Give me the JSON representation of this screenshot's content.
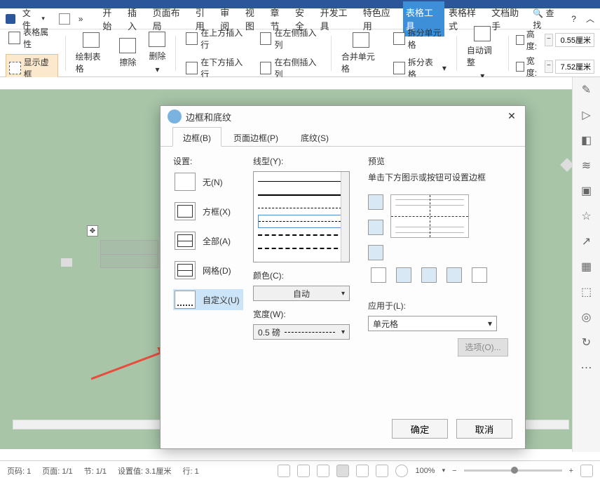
{
  "menu": {
    "file": "文件",
    "tabs": [
      "开始",
      "插入",
      "页面布局",
      "引用",
      "审阅",
      "视图",
      "章节",
      "安全",
      "开发工具",
      "特色应用",
      "表格工具",
      "表格样式",
      "文档助手"
    ],
    "search": "查找",
    "help_icon": "?"
  },
  "ribbon": {
    "table_props": "表格属性",
    "show_frame": "显示虚框",
    "draw_table": "绘制表格",
    "eraser": "擦除",
    "delete": "删除",
    "insert_above": "在上方插入行",
    "insert_below": "在下方插入行",
    "insert_left": "在左侧插入列",
    "insert_right": "在右侧插入列",
    "merge_cells": "合并单元格",
    "split_cells": "拆分单元格",
    "split_table": "拆分表格",
    "auto_adjust": "自动调整",
    "height_label": "高度:",
    "height_val": "0.55厘米",
    "width_label": "宽度:",
    "width_val": "7.52厘米"
  },
  "dialog": {
    "title": "边框和底纹",
    "tabs": {
      "border": "边框(B)",
      "page_border": "页面边框(P)",
      "shading": "底纹(S)"
    },
    "settings_label": "设置:",
    "presets": {
      "none": "无(N)",
      "box": "方框(X)",
      "all": "全部(A)",
      "grid": "网格(D)",
      "custom": "自定义(U)"
    },
    "line_style_label": "线型(Y):",
    "color_label": "颜色(C):",
    "color_value": "自动",
    "width_label": "宽度(W):",
    "width_value": "0.5  磅",
    "preview_label": "预览",
    "preview_text": "单击下方图示或按钮可设置边框",
    "apply_label": "应用于(L):",
    "apply_value": "单元格",
    "options": "选项(O)...",
    "ok": "确定",
    "cancel": "取消"
  },
  "status": {
    "page_no": "页码: 1",
    "page": "页面: 1/1",
    "section": "节: 1/1",
    "set_val": "设置值: 3.1厘米",
    "line": "行: 1",
    "zoom": "100%"
  }
}
